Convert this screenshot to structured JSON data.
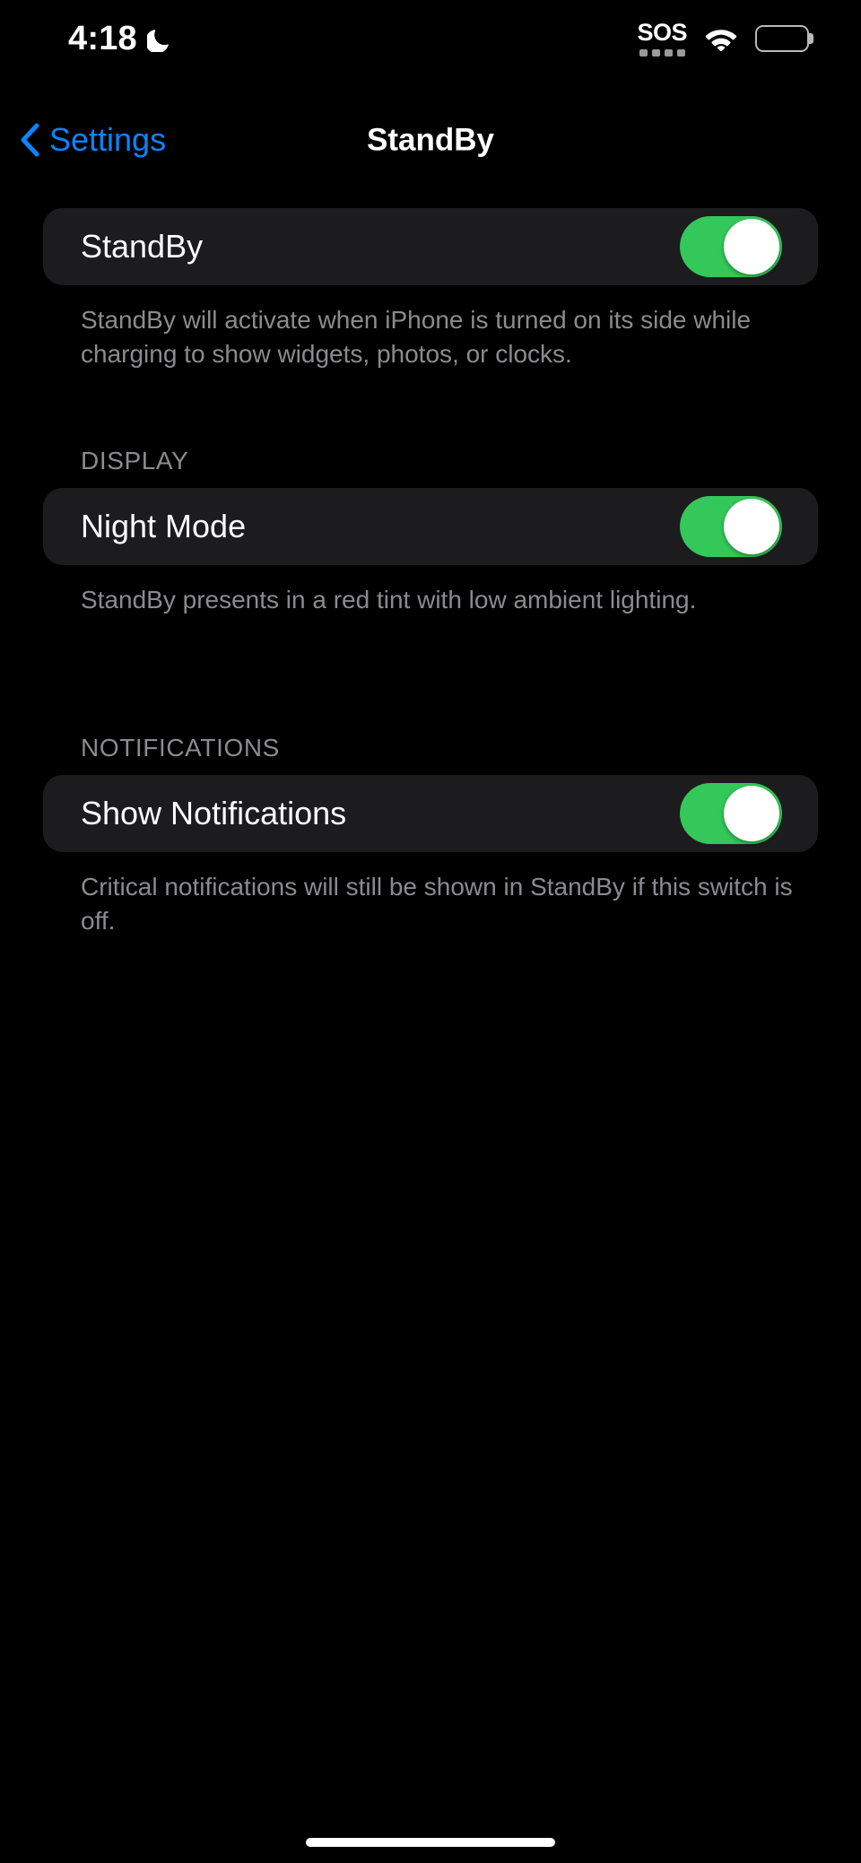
{
  "status_bar": {
    "time": "4:18",
    "moon_icon": "crescent-moon-icon",
    "sos_label": "SOS",
    "signal_dots": 4,
    "wifi_icon": "wifi-icon",
    "battery_icon": "battery-full-icon"
  },
  "nav": {
    "back_label": "Settings",
    "back_icon": "chevron-left-icon",
    "title": "StandBy"
  },
  "groups": [
    {
      "header": "",
      "rows": [
        {
          "label": "StandBy",
          "toggle": "on"
        }
      ],
      "footer": "StandBy will activate when iPhone is turned on its side while charging to show widgets, photos, or clocks."
    },
    {
      "header": "DISPLAY",
      "rows": [
        {
          "label": "Night Mode",
          "toggle": "on"
        }
      ],
      "footer": "StandBy presents in a red tint with low ambient lighting."
    },
    {
      "header": "NOTIFICATIONS",
      "rows": [
        {
          "label": "Show Notifications",
          "toggle": "on"
        }
      ],
      "footer": "Critical notifications will still be shown in StandBy if this switch is off."
    }
  ],
  "colors": {
    "background": "#000000",
    "card": "#1c1c1e",
    "accent_blue": "#0a84ff",
    "toggle_on_green": "#34c759",
    "secondary_text": "#8b8b8f"
  },
  "home_indicator": "home-indicator"
}
